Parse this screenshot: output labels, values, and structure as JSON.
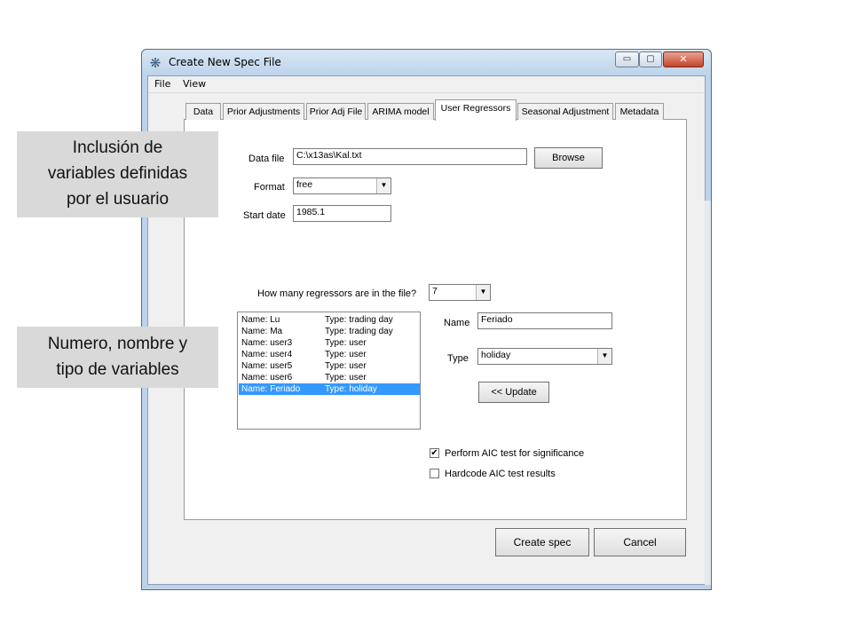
{
  "window": {
    "title": "Create New Spec File",
    "icon": "gear-cluster-icon",
    "controls": {
      "minimize": "▭",
      "maximize": "▢",
      "close": "✕"
    }
  },
  "menu": [
    "File",
    "View"
  ],
  "tabs": [
    "Data",
    "Prior Adjustments",
    "Prior Adj File",
    "ARIMA model",
    "User Regressors",
    "Seasonal Adjustment",
    "Metadata"
  ],
  "active_tab": "User Regressors",
  "form": {
    "data_file_label": "Data file",
    "data_file_value": "C:\\x13as\\Kal.txt",
    "browse_label": "Browse",
    "format_label": "Format",
    "format_value": "free",
    "start_date_label": "Start date",
    "start_date_value": "1985.1",
    "count_question": "How many regressors are in the file?",
    "count_value": "7"
  },
  "regressors": [
    {
      "name": "Name: Lu",
      "type": "Type: trading day"
    },
    {
      "name": "Name: Ma",
      "type": "Type: trading day"
    },
    {
      "name": "Name: user3",
      "type": "Type: user"
    },
    {
      "name": "Name: user4",
      "type": "Type: user"
    },
    {
      "name": "Name: user5",
      "type": "Type: user"
    },
    {
      "name": "Name: user6",
      "type": "Type: user"
    },
    {
      "name": "Name: Feriado",
      "type": "Type: holiday"
    }
  ],
  "selected_regressor_index": 6,
  "editor": {
    "name_label": "Name",
    "name_value": "Feriado",
    "type_label": "Type",
    "type_value": "holiday",
    "update_label": "<< Update"
  },
  "options": {
    "aic_test_label": "Perform AIC test for significance",
    "aic_test_checked": true,
    "hardcode_label": "Hardcode AIC test results",
    "hardcode_checked": false
  },
  "footer": {
    "create_label": "Create spec",
    "cancel_label": "Cancel"
  },
  "annotations": [
    {
      "lines": [
        "Inclusión de",
        "variables definidas",
        "por el usuario"
      ]
    },
    {
      "lines": [
        "Numero, nombre y",
        "tipo de variables"
      ]
    }
  ]
}
